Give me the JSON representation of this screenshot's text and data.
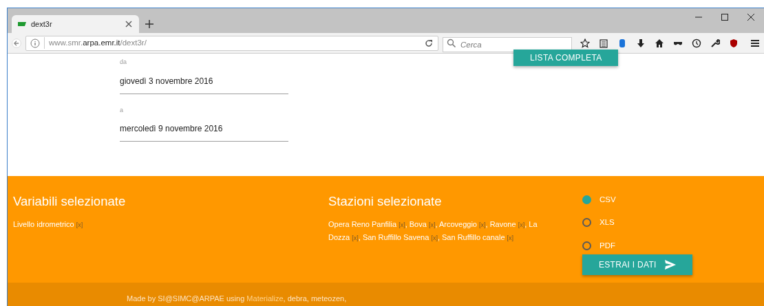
{
  "browser": {
    "tab": {
      "title": "dext3r",
      "selected": true
    },
    "url": {
      "prefix": "www.smr.",
      "domain": "arpa.emr.it",
      "path": "/dext3r/"
    },
    "search": {
      "placeholder": "Cerca"
    }
  },
  "top_button": {
    "label": "LISTA COMPLETA"
  },
  "date_fields": [
    {
      "label": "da",
      "value": "giovedì 3 novembre 2016"
    },
    {
      "label": "a",
      "value": "mercoledì 9 novembre 2016"
    }
  ],
  "variables": {
    "title": "Variabili selezionate",
    "items": [
      {
        "name": "Livello idrometrico",
        "remove": "[x]"
      }
    ]
  },
  "stations": {
    "title": "Stazioni selezionate",
    "items": [
      {
        "name": "Opera Reno Panfilia",
        "remove": "[x]",
        "separator": ","
      },
      {
        "name": "Bova",
        "remove": "[x]",
        "separator": ","
      },
      {
        "name": "Arcoveggio",
        "remove": "[x]",
        "separator": ","
      },
      {
        "name": "Ravone",
        "remove": "[x]",
        "separator": ","
      },
      {
        "name": "La Dozza",
        "remove": "[x]",
        "separator": ","
      },
      {
        "name": "San Ruffillo Savena",
        "remove": "[x]",
        "separator": ","
      },
      {
        "name": "San Ruffillo canale",
        "remove": "[x]"
      }
    ]
  },
  "formats": [
    {
      "label": "CSV",
      "selected": true
    },
    {
      "label": "XLS",
      "selected": false
    },
    {
      "label": "PDF",
      "selected": false
    }
  ],
  "extract_button": {
    "label": "ESTRAI I DATI"
  },
  "footer": [
    {
      "text": "Made by SI@SIMC@ARPAE using ",
      "link": false
    },
    {
      "text": "Materialize",
      "link": true
    },
    {
      "text": ", debra, meteozen,",
      "link": false
    }
  ]
}
